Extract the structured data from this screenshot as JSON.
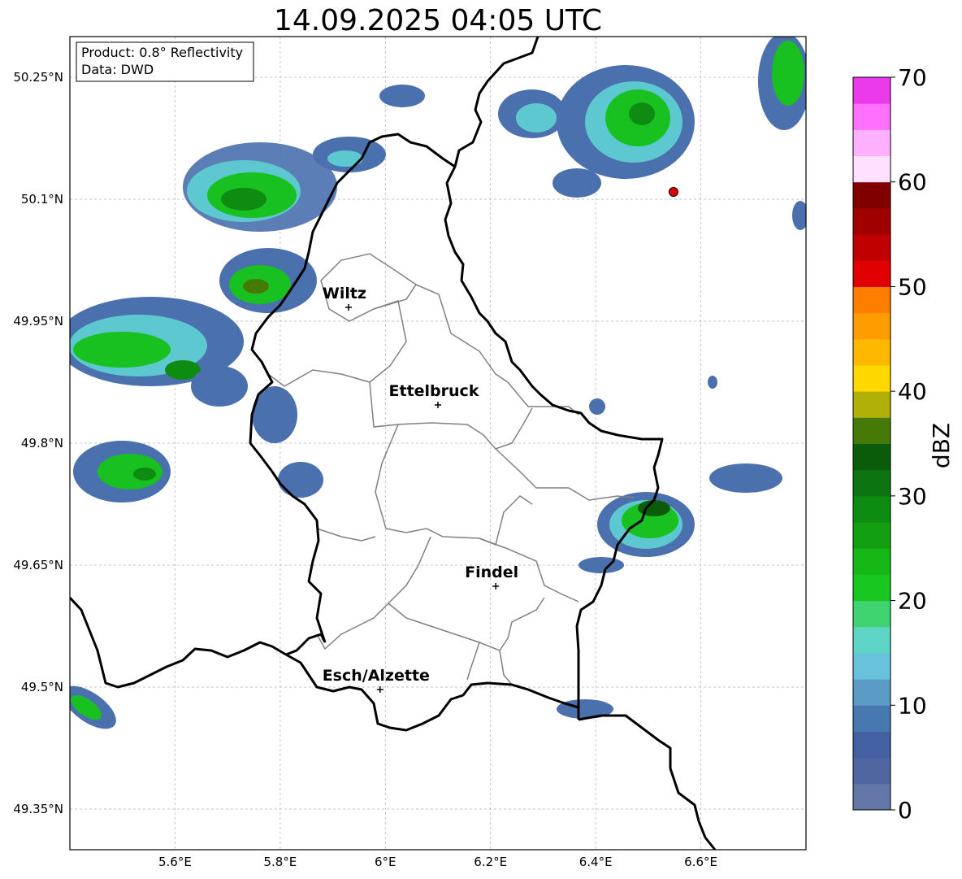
{
  "title": "14.09.2025 04:05 UTC",
  "info_box": {
    "product": "Product: 0.8° Reflectivity",
    "data": "Data: DWD"
  },
  "map": {
    "lon_range": [
      5.4,
      6.8
    ],
    "lat_range": [
      49.3,
      50.3
    ],
    "x_ticks": [
      "5.6°E",
      "5.8°E",
      "6°E",
      "6.2°E",
      "6.4°E",
      "6.6°E"
    ],
    "y_ticks": [
      "50.25°N",
      "50.1°N",
      "49.95°N",
      "49.8°N",
      "49.65°N",
      "49.5°N",
      "49.35°N"
    ],
    "gridlines": true,
    "cities": [
      {
        "name": "Wiltz",
        "lon": 5.93,
        "lat": 49.967
      },
      {
        "name": "Ettelbruck",
        "lon": 6.1,
        "lat": 49.847
      },
      {
        "name": "Findel",
        "lon": 6.21,
        "lat": 49.624
      },
      {
        "name": "Esch/Alzette",
        "lon": 5.99,
        "lat": 49.497
      }
    ],
    "radar_site": {
      "lon": 6.548,
      "lat": 50.109,
      "color": "#e00000"
    }
  },
  "colorbar": {
    "label": "dBZ",
    "ticks": [
      "0",
      "10",
      "20",
      "30",
      "40",
      "50",
      "60",
      "70"
    ],
    "min": 0,
    "max": 70,
    "step": 2.5,
    "colors": [
      "#6577a8",
      "#5066a0",
      "#4260a2",
      "#4878b0",
      "#5a9cc6",
      "#68c2dc",
      "#5ed4c4",
      "#40d470",
      "#18c820",
      "#16b818",
      "#12a012",
      "#0e8c12",
      "#0c7410",
      "#0a5c0a",
      "#467a08",
      "#b0b008",
      "#ffd800",
      "#ffb800",
      "#ff9c00",
      "#ff7e00",
      "#e00000",
      "#c00000",
      "#a00000",
      "#800000",
      "#ffe0ff",
      "#ffb0ff",
      "#ff70ff",
      "#ea3aea"
    ]
  }
}
